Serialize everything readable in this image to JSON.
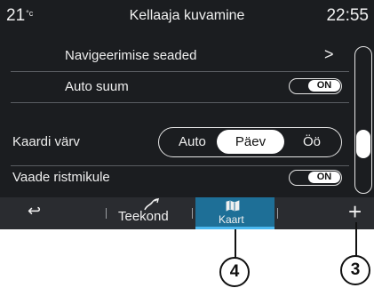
{
  "header": {
    "temperature": "21",
    "temperature_unit": "°c",
    "title": "Kellaaja kuvamine",
    "clock": "22:55"
  },
  "settings": {
    "navigation_settings_label": "Navigeerimise seaded",
    "navigation_settings_arrow": ">",
    "auto_zoom_label": "Auto suum",
    "auto_zoom_state": "ON",
    "map_color_label": "Kaardi värv",
    "map_color_options": [
      "Auto",
      "Päev",
      "Öö"
    ],
    "map_color_selected": "Päev",
    "intersection_view_label": "Vaade ristmikule",
    "intersection_view_state": "ON"
  },
  "bottom_bar": {
    "back_icon": "↩",
    "route_tab": "Teekond",
    "map_tab": "Kaart",
    "add_icon": "+"
  },
  "callouts": {
    "map_tab_number": "4",
    "add_button_number": "3"
  },
  "colors": {
    "background": "#1b1d20",
    "active_tab": "#1e6f97",
    "active_tab_underline": "#4bb8f0"
  }
}
